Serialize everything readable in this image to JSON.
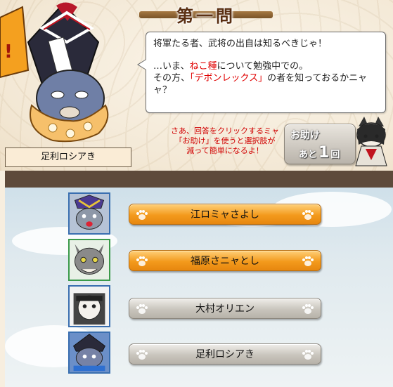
{
  "title": "第一問",
  "question": {
    "line1": "将軍たる者、武将の出自は知るべきじゃ！",
    "line2a": "…いま、",
    "line2_highlight": "ねこ種",
    "line2b": "について勉強中での。",
    "line3a": "その方、",
    "line3_highlight": "「デボンレックス」",
    "line3b": "の者を知っておるかニャ",
    "line4": "ャ？"
  },
  "player_name": "足利ロシアき",
  "hint": {
    "line1": "さあ、回答をクリックするミャ",
    "line2": "「お助け」を使うと選択肢が",
    "line3": "減って簡単になるよ！"
  },
  "help_button": {
    "label": "お助け",
    "remaining_prefix": "あと",
    "remaining_count": "1",
    "remaining_suffix": "回"
  },
  "choices": [
    {
      "label": "江ロミャさよし",
      "state": "active"
    },
    {
      "label": "福原さニャとし",
      "state": "active"
    },
    {
      "label": "大村オリエン",
      "state": "disabled"
    },
    {
      "label": "足利ロシアき",
      "state": "disabled"
    }
  ],
  "colors": {
    "active_button": "#f39a1c",
    "disabled_button": "#c9c5bd",
    "highlight_red": "#e00000",
    "portrait_borders": [
      "#3a6fb0",
      "#3a9a4a",
      "#3a6fb0",
      "#3a6fb0"
    ]
  }
}
